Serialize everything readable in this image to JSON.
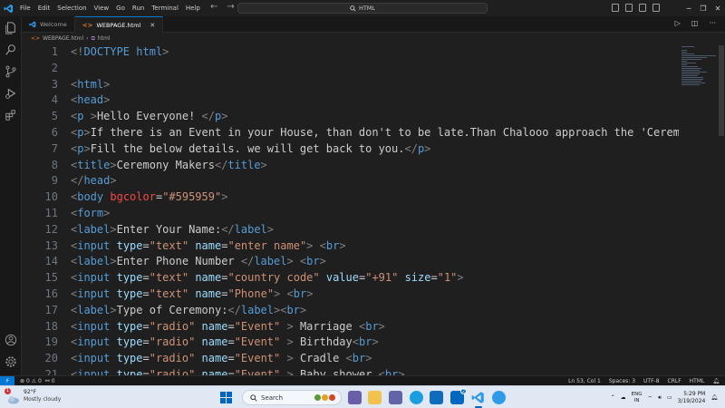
{
  "titlebar": {
    "menu": [
      "File",
      "Edit",
      "Selection",
      "View",
      "Go",
      "Run",
      "Terminal",
      "Help"
    ],
    "search": "HTML"
  },
  "tabs": [
    {
      "label": "Welcome",
      "active": false
    },
    {
      "label": "WEBPAGE.html",
      "active": true
    }
  ],
  "breadcrumb": {
    "file": "WEBPAGE.html",
    "symbol": "html"
  },
  "code_lines": [
    {
      "n": "1",
      "t": [
        [
          "br",
          "<!"
        ],
        [
          "tag",
          "DOCTYPE"
        ],
        [
          "txt",
          " "
        ],
        [
          "tag",
          "html"
        ],
        [
          "br",
          ">"
        ]
      ]
    },
    {
      "n": "2",
      "t": []
    },
    {
      "n": "3",
      "t": [
        [
          "br",
          "<"
        ],
        [
          "tag",
          "html"
        ],
        [
          "br",
          ">"
        ]
      ]
    },
    {
      "n": "4",
      "t": [
        [
          "br",
          "<"
        ],
        [
          "tag",
          "head"
        ],
        [
          "br",
          ">"
        ]
      ]
    },
    {
      "n": "5",
      "t": [
        [
          "br",
          "<"
        ],
        [
          "tag",
          "p"
        ],
        [
          "txt",
          " "
        ],
        [
          "br",
          ">"
        ],
        [
          "txt",
          "Hello Everyone! "
        ],
        [
          "br",
          "</"
        ],
        [
          "tag",
          "p"
        ],
        [
          "br",
          ">"
        ]
      ]
    },
    {
      "n": "6",
      "t": [
        [
          "br",
          "<"
        ],
        [
          "tag",
          "p"
        ],
        [
          "br",
          ">"
        ],
        [
          "txt",
          "If there is an Event in your House, than don't to be late.Than Chalooo approach the 'Ceremony Makers'"
        ]
      ]
    },
    {
      "n": "7",
      "t": [
        [
          "br",
          "<"
        ],
        [
          "tag",
          "p"
        ],
        [
          "br",
          ">"
        ],
        [
          "txt",
          "Fill the below details. we will get back to you."
        ],
        [
          "br",
          "</"
        ],
        [
          "tag",
          "p"
        ],
        [
          "br",
          ">"
        ]
      ]
    },
    {
      "n": "8",
      "t": [
        [
          "br",
          "<"
        ],
        [
          "tag",
          "title"
        ],
        [
          "br",
          ">"
        ],
        [
          "txt",
          "Ceremony Makers"
        ],
        [
          "br",
          "</"
        ],
        [
          "tag",
          "title"
        ],
        [
          "br",
          ">"
        ]
      ]
    },
    {
      "n": "9",
      "t": [
        [
          "br",
          "</"
        ],
        [
          "tag",
          "head"
        ],
        [
          "br",
          ">"
        ]
      ]
    },
    {
      "n": "10",
      "t": [
        [
          "br",
          "<"
        ],
        [
          "tag",
          "body"
        ],
        [
          "txt",
          " "
        ],
        [
          "red",
          "bgcolor"
        ],
        [
          "txt",
          "="
        ],
        [
          "val",
          "\"#595959\""
        ],
        [
          "br",
          ">"
        ]
      ]
    },
    {
      "n": "11",
      "t": [
        [
          "br",
          "<"
        ],
        [
          "tag",
          "form"
        ],
        [
          "br",
          ">"
        ]
      ]
    },
    {
      "n": "12",
      "t": [
        [
          "br",
          "<"
        ],
        [
          "tag",
          "label"
        ],
        [
          "br",
          ">"
        ],
        [
          "txt",
          "Enter Your Name:"
        ],
        [
          "br",
          "</"
        ],
        [
          "tag",
          "label"
        ],
        [
          "br",
          ">"
        ]
      ]
    },
    {
      "n": "13",
      "t": [
        [
          "br",
          "<"
        ],
        [
          "tag",
          "input"
        ],
        [
          "txt",
          " "
        ],
        [
          "attr",
          "type"
        ],
        [
          "txt",
          "="
        ],
        [
          "val",
          "\"text\""
        ],
        [
          "txt",
          " "
        ],
        [
          "attr",
          "name"
        ],
        [
          "txt",
          "="
        ],
        [
          "val",
          "\"enter name\""
        ],
        [
          "br",
          ">"
        ],
        [
          "txt",
          " "
        ],
        [
          "br",
          "<"
        ],
        [
          "tag",
          "br"
        ],
        [
          "br",
          ">"
        ]
      ]
    },
    {
      "n": "14",
      "t": [
        [
          "br",
          "<"
        ],
        [
          "tag",
          "label"
        ],
        [
          "br",
          ">"
        ],
        [
          "txt",
          "Enter Phone Number "
        ],
        [
          "br",
          "</"
        ],
        [
          "tag",
          "label"
        ],
        [
          "br",
          ">"
        ],
        [
          "txt",
          " "
        ],
        [
          "br",
          "<"
        ],
        [
          "tag",
          "br"
        ],
        [
          "br",
          ">"
        ]
      ]
    },
    {
      "n": "15",
      "t": [
        [
          "br",
          "<"
        ],
        [
          "tag",
          "input"
        ],
        [
          "txt",
          " "
        ],
        [
          "attr",
          "type"
        ],
        [
          "txt",
          "="
        ],
        [
          "val",
          "\"text\""
        ],
        [
          "txt",
          " "
        ],
        [
          "attr",
          "name"
        ],
        [
          "txt",
          "="
        ],
        [
          "val",
          "\"country code\""
        ],
        [
          "txt",
          " "
        ],
        [
          "attr",
          "value"
        ],
        [
          "txt",
          "="
        ],
        [
          "val",
          "\"+91\""
        ],
        [
          "txt",
          " "
        ],
        [
          "attr",
          "size"
        ],
        [
          "txt",
          "="
        ],
        [
          "val",
          "\"1\""
        ],
        [
          "br",
          ">"
        ]
      ]
    },
    {
      "n": "16",
      "t": [
        [
          "br",
          "<"
        ],
        [
          "tag",
          "input"
        ],
        [
          "txt",
          " "
        ],
        [
          "attr",
          "type"
        ],
        [
          "txt",
          "="
        ],
        [
          "val",
          "\"text\""
        ],
        [
          "txt",
          " "
        ],
        [
          "attr",
          "name"
        ],
        [
          "txt",
          "="
        ],
        [
          "val",
          "\"Phone\""
        ],
        [
          "br",
          ">"
        ],
        [
          "txt",
          " "
        ],
        [
          "br",
          "<"
        ],
        [
          "tag",
          "br"
        ],
        [
          "br",
          ">"
        ]
      ]
    },
    {
      "n": "17",
      "t": [
        [
          "br",
          "<"
        ],
        [
          "tag",
          "label"
        ],
        [
          "br",
          ">"
        ],
        [
          "txt",
          "Type of Ceremony:"
        ],
        [
          "br",
          "</"
        ],
        [
          "tag",
          "label"
        ],
        [
          "br",
          "><"
        ],
        [
          "tag",
          "br"
        ],
        [
          "br",
          ">"
        ]
      ]
    },
    {
      "n": "18",
      "t": [
        [
          "br",
          "<"
        ],
        [
          "tag",
          "input"
        ],
        [
          "txt",
          " "
        ],
        [
          "attr",
          "type"
        ],
        [
          "txt",
          "="
        ],
        [
          "val",
          "\"radio\""
        ],
        [
          "txt",
          " "
        ],
        [
          "attr",
          "name"
        ],
        [
          "txt",
          "="
        ],
        [
          "val",
          "\"Event\""
        ],
        [
          "txt",
          " "
        ],
        [
          "br",
          ">"
        ],
        [
          "txt",
          " Marriage "
        ],
        [
          "br",
          "<"
        ],
        [
          "tag",
          "br"
        ],
        [
          "br",
          ">"
        ]
      ]
    },
    {
      "n": "19",
      "t": [
        [
          "br",
          "<"
        ],
        [
          "tag",
          "input"
        ],
        [
          "txt",
          " "
        ],
        [
          "attr",
          "type"
        ],
        [
          "txt",
          "="
        ],
        [
          "val",
          "\"radio\""
        ],
        [
          "txt",
          " "
        ],
        [
          "attr",
          "name"
        ],
        [
          "txt",
          "="
        ],
        [
          "val",
          "\"Event\""
        ],
        [
          "txt",
          " "
        ],
        [
          "br",
          ">"
        ],
        [
          "txt",
          " Birthday"
        ],
        [
          "br",
          "<"
        ],
        [
          "tag",
          "br"
        ],
        [
          "br",
          ">"
        ]
      ]
    },
    {
      "n": "20",
      "t": [
        [
          "br",
          "<"
        ],
        [
          "tag",
          "input"
        ],
        [
          "txt",
          " "
        ],
        [
          "attr",
          "type"
        ],
        [
          "txt",
          "="
        ],
        [
          "val",
          "\"radio\""
        ],
        [
          "txt",
          " "
        ],
        [
          "attr",
          "name"
        ],
        [
          "txt",
          "="
        ],
        [
          "val",
          "\"Event\""
        ],
        [
          "txt",
          " "
        ],
        [
          "br",
          ">"
        ],
        [
          "txt",
          " Cradle "
        ],
        [
          "br",
          "<"
        ],
        [
          "tag",
          "br"
        ],
        [
          "br",
          ">"
        ]
      ]
    },
    {
      "n": "21",
      "t": [
        [
          "br",
          "<"
        ],
        [
          "tag",
          "input"
        ],
        [
          "txt",
          " "
        ],
        [
          "attr",
          "type"
        ],
        [
          "txt",
          "="
        ],
        [
          "val",
          "\"radio\""
        ],
        [
          "txt",
          " "
        ],
        [
          "attr",
          "name"
        ],
        [
          "txt",
          "="
        ],
        [
          "val",
          "\"Event\""
        ],
        [
          "txt",
          " "
        ],
        [
          "br",
          ">"
        ],
        [
          "txt",
          " Baby shower "
        ],
        [
          "br",
          "<"
        ],
        [
          "tag",
          "br"
        ],
        [
          "br",
          ">"
        ]
      ]
    }
  ],
  "statusbar": {
    "errors": "0",
    "warnings": "0",
    "ports": "0",
    "position": "Ln 53, Col 1",
    "spaces": "Spaces: 3",
    "encoding": "UTF-8",
    "eol": "CRLF",
    "language": "HTML"
  },
  "taskbar": {
    "weather_temp": "92°F",
    "weather_cond": "Mostly cloudy",
    "weather_badge": "1",
    "search_placeholder": "Search",
    "lang_line1": "ENG",
    "lang_line2": "IN",
    "time": "5:29 PM",
    "date": "3/19/2024",
    "store_badge": "2"
  },
  "colors": {
    "accent": "#0078d4",
    "tag": "#569cd6",
    "attr": "#9cdcfe",
    "string": "#ce9178",
    "error_attr": "#f44747"
  }
}
